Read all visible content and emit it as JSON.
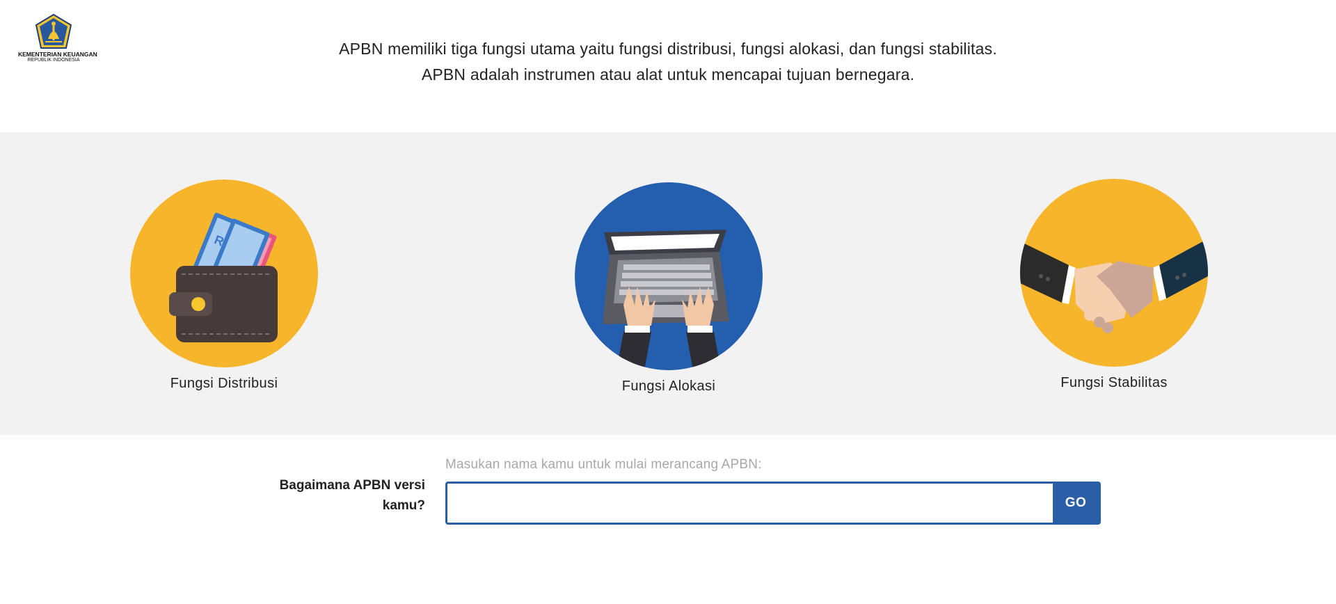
{
  "logo": {
    "line1": "KEMENTERIAN KEUANGAN",
    "line2": "REPUBLIK INDONESIA",
    "icon": "kemenkeu-emblem"
  },
  "intro": {
    "line1": "APBN memiliki tiga fungsi utama yaitu fungsi distribusi, fungsi alokasi, dan fungsi stabilitas.",
    "line2": "APBN adalah instrumen atau alat untuk mencapai tujuan bernegara."
  },
  "functions": [
    {
      "label": "Fungsi Distribusi",
      "icon": "wallet-money-icon",
      "color": "#f7b52c"
    },
    {
      "label": "Fungsi Alokasi",
      "icon": "laptop-typing-icon",
      "color": "#245eae"
    },
    {
      "label": "Fungsi Stabilitas",
      "icon": "handshake-icon",
      "color": "#f7b52c"
    }
  ],
  "form": {
    "question": "Bagaimana APBN versi kamu?",
    "hint": "Masukan nama kamu untuk mulai merancang APBN:",
    "input_value": "",
    "button_label": "GO",
    "accent": "#2a5fa8"
  }
}
